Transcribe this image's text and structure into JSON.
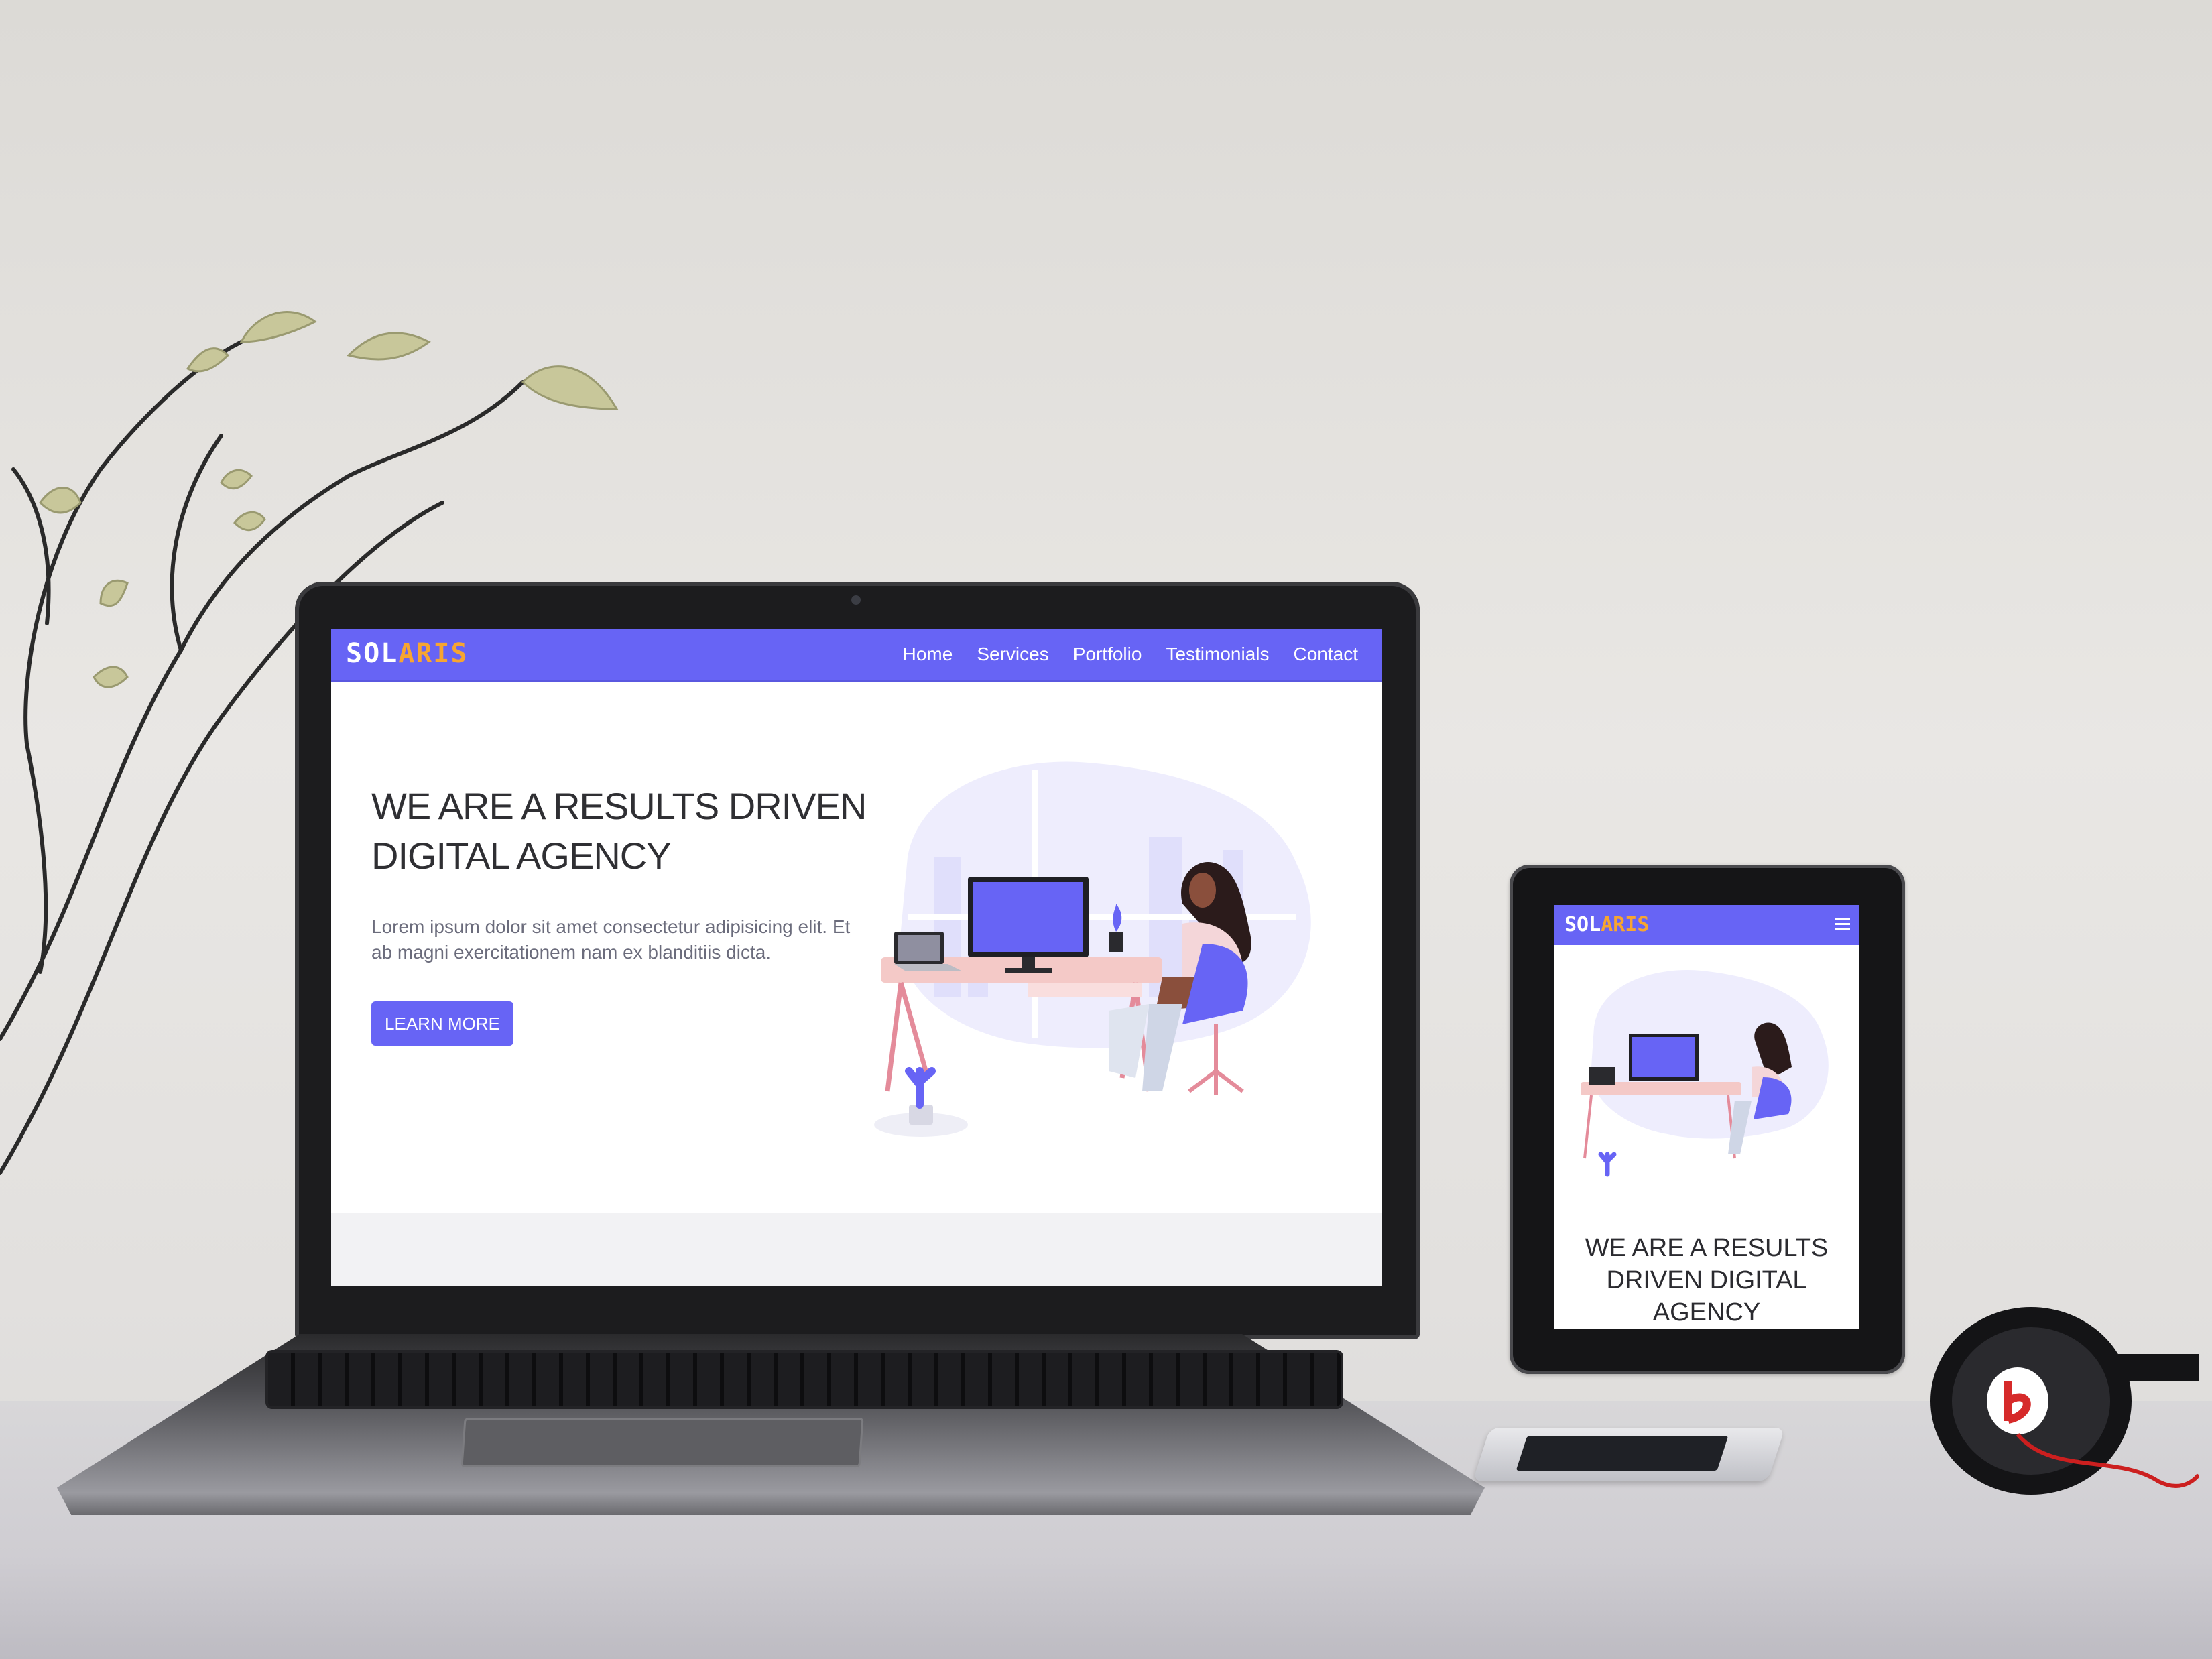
{
  "site": {
    "brand_part1": "SOL",
    "brand_part2": "ARIS",
    "nav": [
      "Home",
      "Services",
      "Portfolio",
      "Testimonials",
      "Contact"
    ],
    "hero_title": "WE ARE A RESULTS DRIVEN DIGITAL AGENCY",
    "hero_text": "Lorem ipsum dolor sit amet consectetur adipisicing elit. Et ab magni exercitationem nam ex blanditiis dicta.",
    "cta_label": "LEARN MORE"
  },
  "tablet": {
    "brand_part1": "SOL",
    "brand_part2": "ARIS",
    "hero_title": "WE ARE A RESULTS DRIVEN DIGITAL AGENCY"
  },
  "colors": {
    "brand_primary": "#6764f5",
    "brand_accent": "#f7a531",
    "heading": "#2f2f33",
    "body_text": "#6b6c7c"
  },
  "icons": [
    "hamburger-menu-icon",
    "headphones-icon",
    "phone-icon",
    "plant-icon"
  ]
}
